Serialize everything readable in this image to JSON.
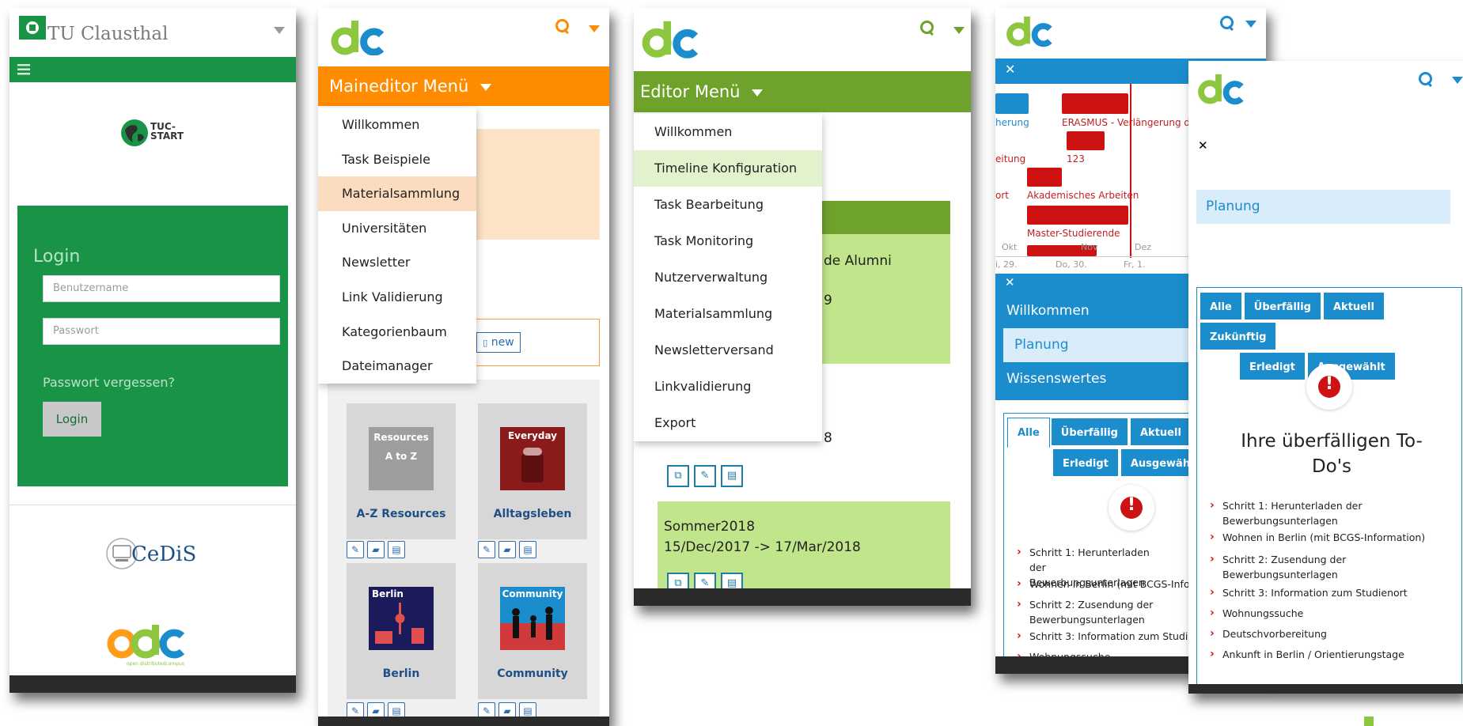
{
  "phone1": {
    "brand_title": "TU Clausthal",
    "logo_tuc_start": "TUC-\nSTART",
    "login": {
      "title": "Login",
      "username_placeholder": "Benutzername",
      "password_placeholder": "Passwort",
      "forgot_link": "Passwort vergessen?",
      "button": "Login"
    },
    "logo_cedis": "CeDiS",
    "logo_odc_caption": "open distributedcampus"
  },
  "phone2": {
    "menu_title": "Maineditor Menü",
    "menu_items": [
      "Willkommen",
      "Task Beispiele",
      "Materialsammlung",
      "Universitäten",
      "Newsletter",
      "Link Validierung",
      "Kategorienbaum",
      "Dateimanager"
    ],
    "active_item": "Materialsammlung",
    "new_button": "new",
    "cards": [
      {
        "label": "A-Z Resources",
        "thumb_text_1": "Resources",
        "thumb_text_2": "A to Z"
      },
      {
        "label": "Alltagsleben",
        "thumb_text_1": "Everyday"
      },
      {
        "label": "Berlin",
        "thumb_text_1": "Berlin"
      },
      {
        "label": "Community",
        "thumb_text_1": "Community"
      }
    ]
  },
  "phone3": {
    "menu_title": "Editor Menü",
    "menu_items": [
      "Willkommen",
      "Timeline Konfiguration",
      "Task Bearbeitung",
      "Task Monitoring",
      "Nutzerverwaltung",
      "Materialsammlung",
      "Newsletterversand",
      "Linkvalidierung",
      "Export"
    ],
    "active_item": "Timeline Konfiguration",
    "card1_line1": "de Alumni",
    "card1_line2": "9",
    "card2_line": "8",
    "card3_title": "Sommer2018",
    "card3_dates": "15/Dec/2017 -> 17/Mar/2018"
  },
  "phone4": {
    "gantt_labels": [
      "herung",
      "ERASMUS - Verlängerung de",
      "eitung",
      "123",
      "ort",
      "Akademisches Arbeiten",
      "Master-Studierende"
    ],
    "gantt_months": [
      "Okt",
      "Nov",
      "Dez"
    ],
    "gantt_days": [
      "i, 29.",
      "Do, 30.",
      "Fr, 1."
    ],
    "nav_items": [
      "Willkommen",
      "Planung",
      "Wissenswertes"
    ],
    "active_nav": "Planung",
    "tabs_row1": [
      "Alle",
      "Überfällig",
      "Aktuell"
    ],
    "tabs_row2": [
      "Erledigt",
      "Ausgewählt"
    ],
    "todos": [
      "Schritt 1: Herunterladen der Bewerbungsunterlagen",
      "Wohnen in Berlin (mit BCGS-Info",
      "Schritt 2: Zusendung der Bewerbungsunterlagen",
      "Schritt 3: Information zum Studi",
      "Wohnungssuche"
    ]
  },
  "phone5": {
    "nav_items": [
      "Willkommen",
      "Planung",
      "Wissenswertes"
    ],
    "active_nav": "Planung",
    "tabs_row1": [
      "Alle",
      "Überfällig",
      "Aktuell",
      "Zukünftig"
    ],
    "tabs_row2": [
      "Erledigt",
      "Ausgewählt"
    ],
    "heading": "Ihre überfälligen To-Do's",
    "todos": [
      "Schritt 1: Herunterladen der Bewerbungsunterlagen",
      "Wohnen in Berlin (mit BCGS-Information)",
      "Schritt 2: Zusendung der Bewerbungsunterlagen",
      "Schritt 3: Information zum Studienort",
      "Wohnungssuche",
      "Deutschvorbereitung",
      "Ankunft in Berlin / Orientierungstage"
    ]
  },
  "colors": {
    "tuc_green": "#199447",
    "orange": "#ff8c00",
    "olive": "#6ea22a",
    "light_green": "#c1e58a",
    "blue": "#1c8dcc",
    "alert_red": "#cc1212"
  }
}
